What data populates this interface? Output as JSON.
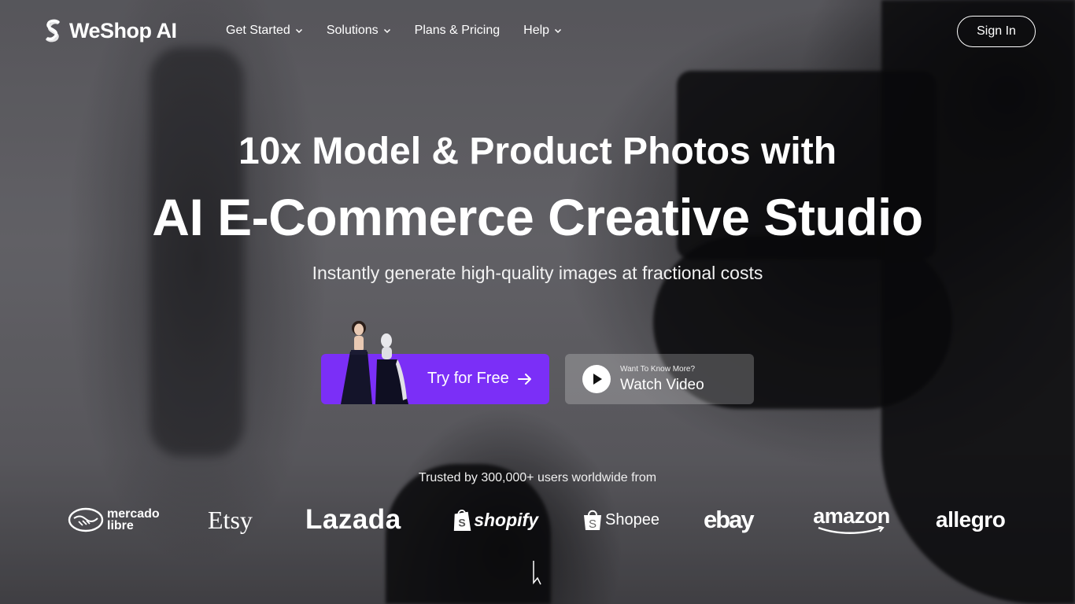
{
  "header": {
    "logo_text": "WeShop AI",
    "logo_icon": "weshop-logo-icon",
    "nav": [
      {
        "label": "Get Started",
        "has_dropdown": true
      },
      {
        "label": "Solutions",
        "has_dropdown": true
      },
      {
        "label": "Plans & Pricing",
        "has_dropdown": false
      },
      {
        "label": "Help",
        "has_dropdown": true
      }
    ],
    "sign_in_label": "Sign In"
  },
  "hero": {
    "title_line1": "10x Model & Product Photos with",
    "title_line2": "AI E-Commerce Creative Studio",
    "subtitle": "Instantly generate high-quality images at fractional costs",
    "cta_primary_label": "Try for Free",
    "cta_secondary_small": "Want To Know More?",
    "cta_secondary_label": "Watch Video"
  },
  "trust": {
    "text": "Trusted by 300,000+ users worldwide from",
    "brands": [
      {
        "name": "mercado libre",
        "icon": "mercado-libre-logo"
      },
      {
        "name": "Etsy",
        "icon": "etsy-logo"
      },
      {
        "name": "Lazada",
        "icon": "lazada-logo"
      },
      {
        "name": "shopify",
        "icon": "shopify-logo"
      },
      {
        "name": "Shopee",
        "icon": "shopee-logo"
      },
      {
        "name": "ebay",
        "icon": "ebay-logo"
      },
      {
        "name": "amazon",
        "icon": "amazon-logo"
      },
      {
        "name": "allegro",
        "icon": "allegro-logo"
      }
    ]
  },
  "colors": {
    "accent": "#7b2ff7",
    "text": "#ffffff"
  }
}
